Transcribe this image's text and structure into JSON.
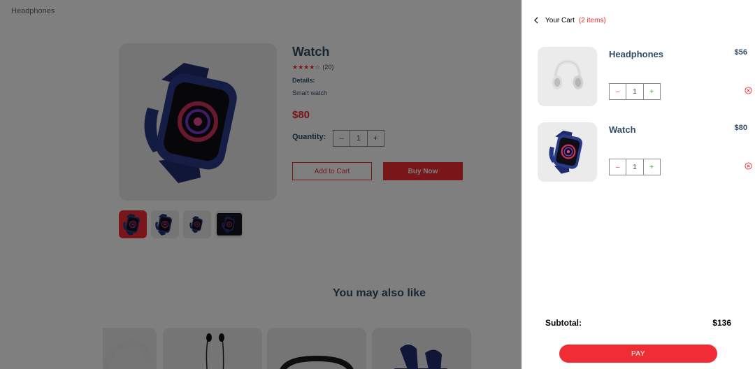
{
  "nav": {
    "logo": "Headphones"
  },
  "product": {
    "title": "Watch",
    "stars": "★★★★☆",
    "rating_count": "(20)",
    "details_heading": "Details:",
    "details": "Smart watch",
    "price": "$80",
    "quantity_label": "Quantity:",
    "quantity": {
      "minus": "–",
      "value": "1",
      "plus": "+"
    },
    "add_to_cart": "Add to Cart",
    "buy_now": "Buy Now"
  },
  "also_like": {
    "title": "You may also like"
  },
  "cart": {
    "heading": "Your Cart",
    "count": "(2 items)",
    "items": [
      {
        "name": "Headphones",
        "price": "$56",
        "qty": "1",
        "minus": "–",
        "plus": "+"
      },
      {
        "name": "Watch",
        "price": "$80",
        "qty": "1",
        "minus": "–",
        "plus": "+"
      }
    ],
    "subtotal_label": "Subtotal:",
    "subtotal_value": "$136",
    "pay_label": "PAY"
  },
  "colors": {
    "accent": "#f02d34",
    "text": "#324d67",
    "overlay": "rgba(0,0,0,0.5)"
  }
}
